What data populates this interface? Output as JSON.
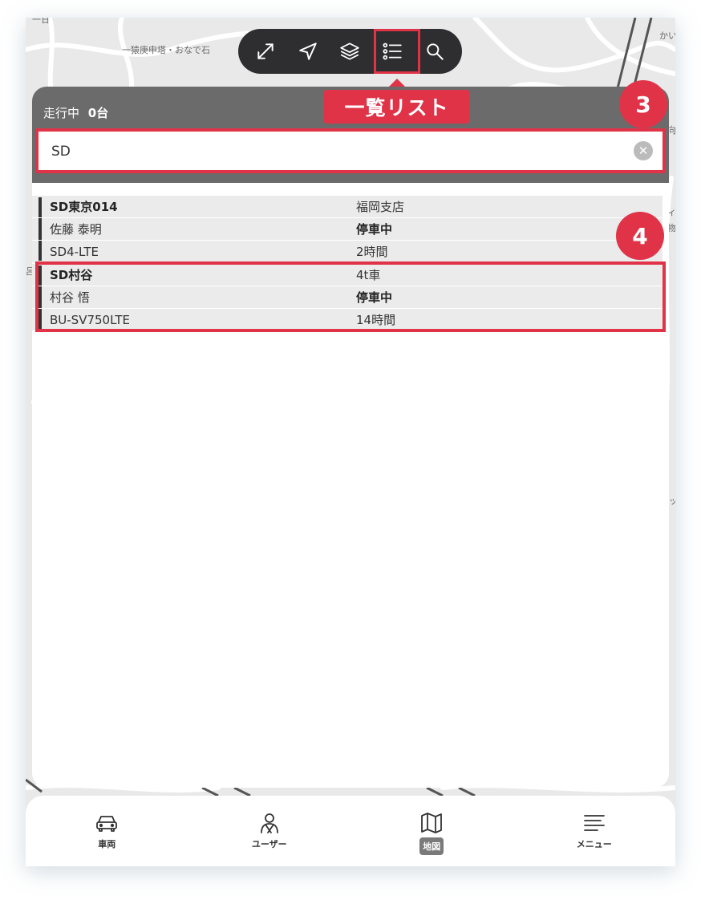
{
  "map": {
    "labels": [
      "一猿庚申塔・おなで石",
      "一日",
      "かい",
      "ィ",
      "物",
      "向",
      "呂",
      "ッ"
    ]
  },
  "toolbar": {
    "icons": [
      "expand-icon",
      "navigation-icon",
      "layers-icon",
      "list-icon",
      "search-icon"
    ]
  },
  "annotations": {
    "list_callout": "一覧リスト",
    "badge_search": "3",
    "badge_list": "4",
    "accent": "#e03347"
  },
  "panel": {
    "status_label": "走行中",
    "status_count": "0台",
    "search": {
      "value": "SD",
      "clear_icon": "clear-icon"
    }
  },
  "vehicles": [
    {
      "name": "SD東京014",
      "branch": "福岡支店",
      "driver": "佐藤 泰明",
      "status": "停車中",
      "device": "SD4-LTE",
      "duration": "2時間"
    },
    {
      "name": "SD村谷",
      "branch": "4t車",
      "driver": "村谷 悟",
      "status": "停車中",
      "device": "BU-SV750LTE",
      "duration": "14時間"
    }
  ],
  "tabs": [
    {
      "label": "車両",
      "icon": "car-icon"
    },
    {
      "label": "ユーザー",
      "icon": "user-icon"
    },
    {
      "label": "地図",
      "icon": "map-icon",
      "active": true
    },
    {
      "label": "メニュー",
      "icon": "menu-icon"
    }
  ]
}
